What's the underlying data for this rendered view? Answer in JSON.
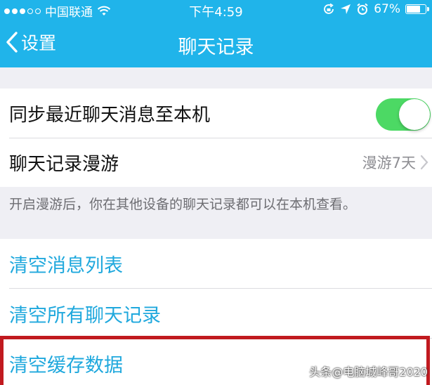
{
  "status_bar": {
    "carrier": "中国联通",
    "time": "下午4:59",
    "battery_percent_text": "67%",
    "battery_level": 0.67,
    "icons": [
      "signal-dots-icon",
      "wifi-icon",
      "lock-rotation-icon",
      "location-arrow-icon",
      "alarm-icon",
      "battery-icon"
    ]
  },
  "nav": {
    "back_label": "设置",
    "title": "聊天记录"
  },
  "settings": {
    "sync_label": "同步最近聊天消息至本机",
    "sync_enabled": true,
    "roaming_label": "聊天记录漫游",
    "roaming_value": "漫游7天",
    "roaming_note": "开启漫游后，你在其他设备的聊天记录都可以在本机查看。"
  },
  "actions": {
    "clear_message_list": "清空消息列表",
    "clear_all_chat_history": "清空所有聊天记录",
    "clear_cache_data": "清空缓存数据"
  },
  "watermark": {
    "text": "头条@电脑城峰哥2020"
  },
  "colors": {
    "nav_blue": "#20b4ea",
    "action_blue": "#1fa8dd",
    "toggle_green": "#4cd964",
    "highlight_red": "#c11a1f"
  }
}
